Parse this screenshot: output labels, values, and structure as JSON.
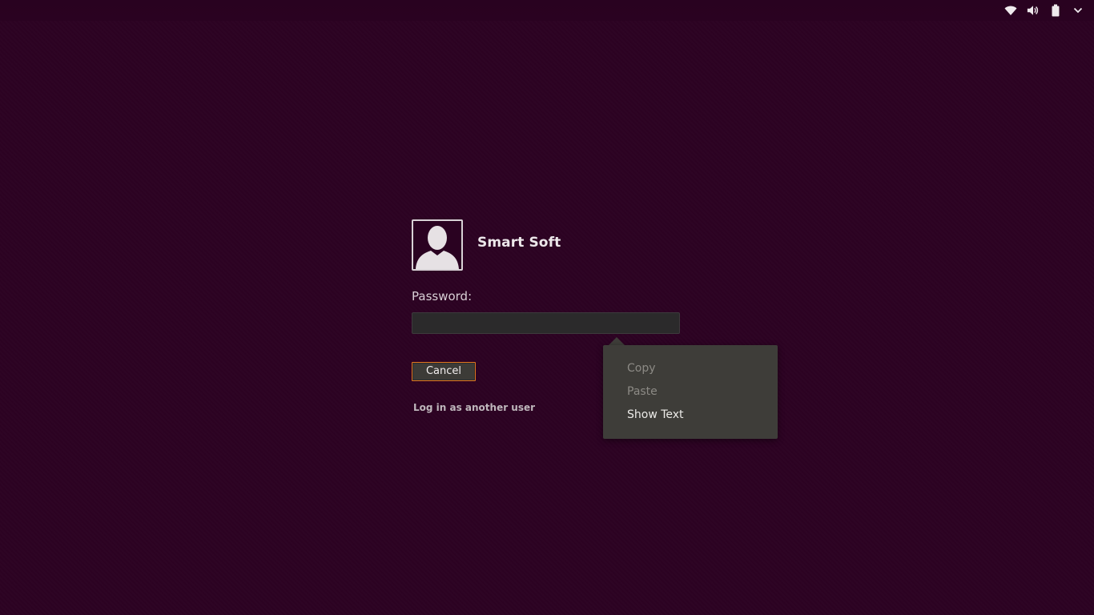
{
  "panel": {
    "icons": [
      "wifi-icon",
      "volume-icon",
      "battery-icon",
      "chevron-down-icon"
    ]
  },
  "login": {
    "user_name": "Smart Soft",
    "password_label": "Password:",
    "password_value": "",
    "cancel_label": "Cancel",
    "other_user_label": "Log in as another user"
  },
  "context_menu": {
    "items": [
      {
        "label": "Copy",
        "enabled": false
      },
      {
        "label": "Paste",
        "enabled": false
      },
      {
        "label": "Show Text",
        "enabled": true
      }
    ]
  },
  "colors": {
    "background": "#2c0222",
    "accent": "#e0761f",
    "menu_bg": "#3e3d39"
  }
}
